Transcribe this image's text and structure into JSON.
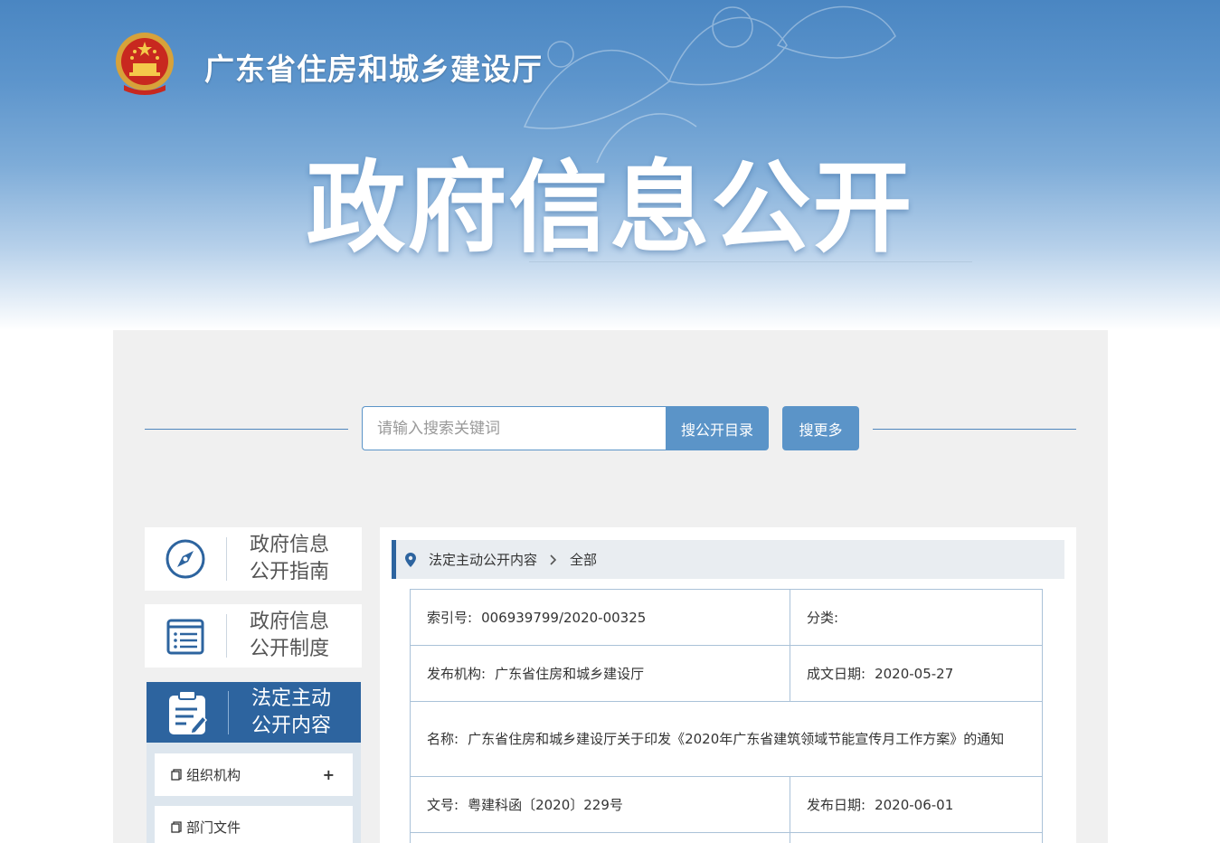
{
  "header": {
    "site_title": "广东省住房和城乡建设厅",
    "big_title": "政府信息公开"
  },
  "search": {
    "placeholder": "请输入搜索关键词",
    "btn_directory": "搜公开目录",
    "btn_more": "搜更多"
  },
  "sidebar": {
    "items": [
      {
        "line1": "政府信息",
        "line2": "公开指南",
        "icon": "compass-icon"
      },
      {
        "line1": "政府信息",
        "line2": "公开制度",
        "icon": "list-document-icon"
      },
      {
        "line1": "法定主动",
        "line2": "公开内容",
        "icon": "clipboard-edit-icon"
      }
    ],
    "sub_items": [
      {
        "label": "组织机构",
        "expand": "+"
      },
      {
        "label": "部门文件"
      }
    ]
  },
  "breadcrumb": {
    "section": "法定主动公开内容",
    "current": "全部"
  },
  "meta": {
    "index_label": "索引号:",
    "index_value": "006939799/2020-00325",
    "category_label": "分类:",
    "category_value": "",
    "publisher_label": "发布机构:",
    "publisher_value": "广东省住房和城乡建设厅",
    "created_label": "成文日期:",
    "created_value": "2020-05-27",
    "name_label": "名称:",
    "name_value": "广东省住房和城乡建设厅关于印发《2020年广东省建筑领域节能宣传月工作方案》的通知",
    "docno_label": "文号:",
    "docno_value": "粤建科函〔2020〕229号",
    "published_label": "发布日期:",
    "published_value": "2020-06-01"
  },
  "colors": {
    "primary": "#2d649f",
    "button": "#5b94c8",
    "content_bg": "#f0f0f0"
  }
}
